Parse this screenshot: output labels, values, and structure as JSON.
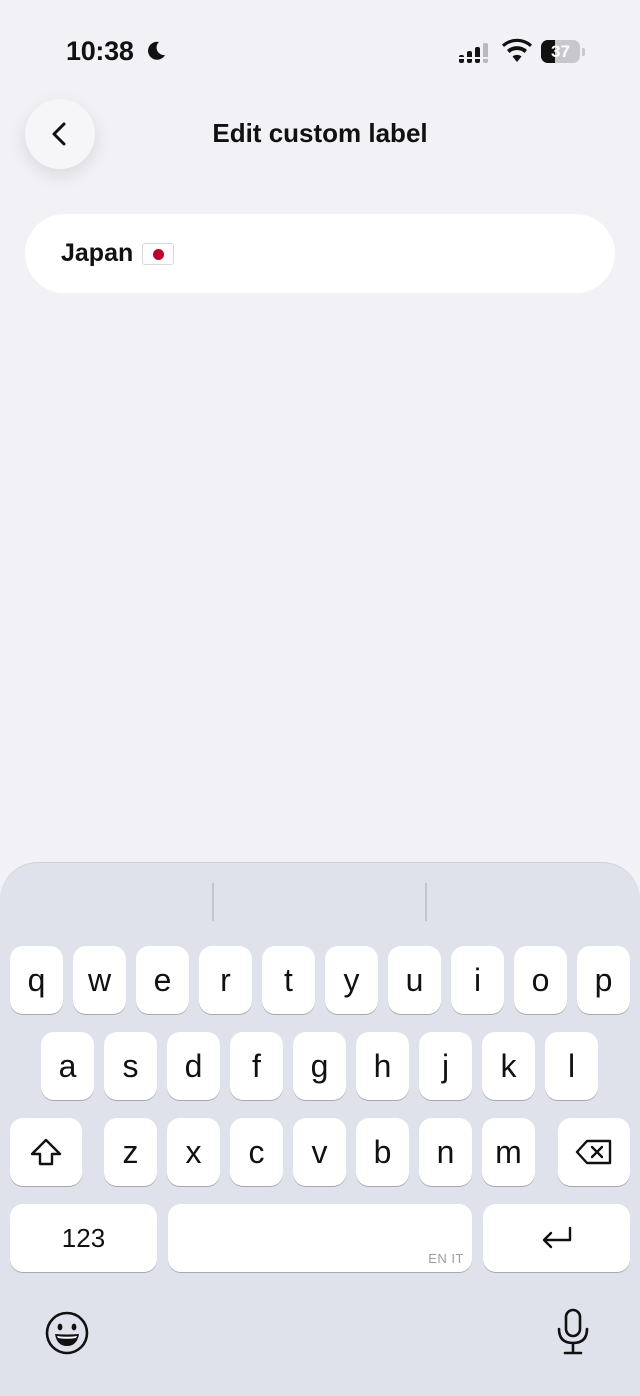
{
  "status_bar": {
    "time": "10:38",
    "battery_level": "37"
  },
  "header": {
    "title": "Edit custom label",
    "back_icon": "chevron-left-icon"
  },
  "label_field": {
    "value": "Japan",
    "flag": "japan-flag-icon"
  },
  "keyboard": {
    "row1": [
      "q",
      "w",
      "e",
      "r",
      "t",
      "y",
      "u",
      "i",
      "o",
      "p"
    ],
    "row2": [
      "a",
      "s",
      "d",
      "f",
      "g",
      "h",
      "j",
      "k",
      "l"
    ],
    "row3": [
      "z",
      "x",
      "c",
      "v",
      "b",
      "n",
      "m"
    ],
    "numbers_label": "123",
    "space_hint": "EN IT",
    "shift_icon": "shift-icon",
    "backspace_icon": "backspace-icon",
    "return_icon": "return-icon",
    "emoji_icon": "emoji-icon",
    "microphone_icon": "microphone-icon"
  },
  "colors": {
    "background": "#f1f1f6",
    "keyboard_bg": "#dfe2ea",
    "key_bg": "#ffffff",
    "flag_red": "#bc002d"
  }
}
